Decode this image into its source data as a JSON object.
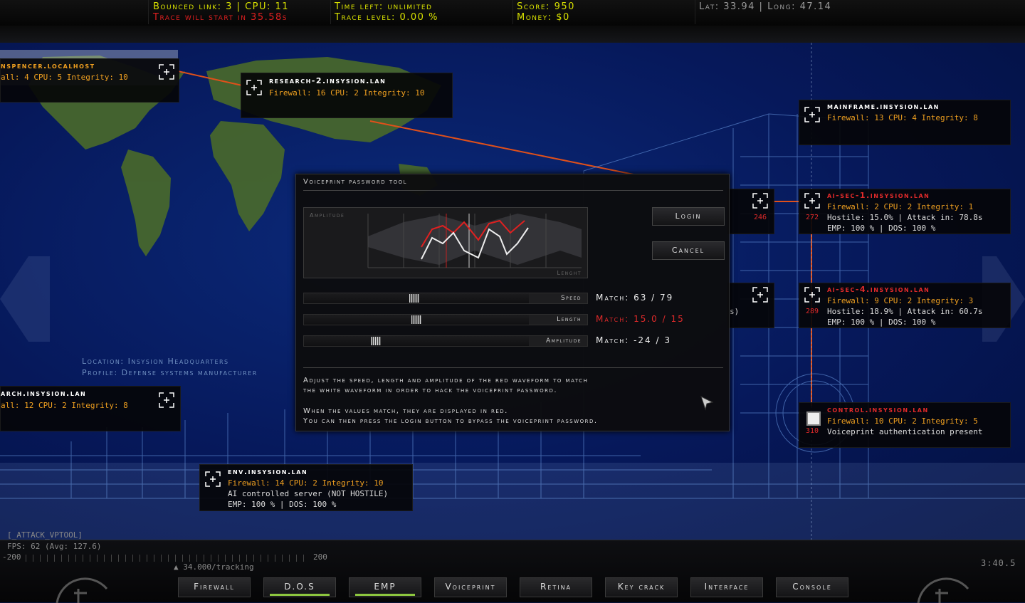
{
  "hud": {
    "bounced_link": "Bounced link: 3 | CPU: 11",
    "trace_start": "Trace will start in 35.58s",
    "time_left": "Time left: unlimited",
    "trace_level": "Trace level: 0.00 %",
    "score": "Score: 950",
    "money": "Money: $0",
    "coords": "Lat: 33.94 | Long: 47.14"
  },
  "location": {
    "line1": "Location: Insysion Headquarters",
    "line2": "Profile: Defense systems manufacturer"
  },
  "nodes": {
    "spencer": {
      "name": "nspencer.localhost",
      "line1": "all: 4 CPU: 5 Integrity: 10"
    },
    "research2": {
      "name": "research-2.insysion.lan",
      "line1": "Firewall: 16 CPU: 2 Integrity: 10"
    },
    "mainframe": {
      "name": "mainframe.insysion.lan",
      "line1": "Firewall: 13 CPU: 4 Integrity: 8"
    },
    "aisec1": {
      "name": "ai-sec-1.insysion.lan",
      "line1": "Firewall: 2 CPU: 2 Integrity: 1",
      "line2": "Hostile: 15.0% | Attack in: 78.8s",
      "line3": "EMP: 100 % | DOS: 100 %",
      "num": "272",
      "leftnum": "246"
    },
    "aisec4": {
      "name": "ai-sec-4.insysion.lan",
      "line1": "Firewall: 9 CPU: 2 Integrity: 3",
      "line2": "Hostile: 18.9% | Attack in: 60.7s",
      "line3": "EMP: 100 % | DOS: 100 %",
      "num": "289",
      "partial": "s)"
    },
    "research": {
      "name": "arch.insysion.lan",
      "line1": "all: 12 CPU: 2 Integrity: 8"
    },
    "control": {
      "name": "control.insysion.lan",
      "line1": "Firewall: 10 CPU: 2 Integrity: 5",
      "line2": "Voiceprint authentication present",
      "num": "310"
    },
    "env": {
      "name": "env.insysion.lan",
      "line1": "Firewall: 14 CPU: 2 Integrity: 10",
      "line2": "AI controlled server (NOT HOSTILE)",
      "line3": "EMP: 100 % | DOS: 100 %"
    }
  },
  "dialog": {
    "title": "Voiceprint password tool",
    "amplitude_label": "Amplitude",
    "length_axis": "Lenght",
    "login": "Login",
    "cancel": "Cancel",
    "speed_label": "Speed",
    "length_label": "Length",
    "amp_label": "Amplitude",
    "speed_match": "Match: 63 / 79",
    "length_match": "Match: 15.0 / 15",
    "amp_match": "Match: -24 / 3",
    "speed_value": 0.49,
    "length_value": 0.5,
    "amplitude_value": 0.31,
    "instr1": "Adjust the speed, length and amplitude of the red waveform to match",
    "instr2": "the white waveform in order to hack the voiceprint password.",
    "instr3": "When the values match, they are displayed in red.",
    "instr4": "You can then press the login button to bypass the voiceprint password."
  },
  "bottom": {
    "attack_tag": "[_ATTACK_VPTOOL]",
    "fps": "FPS:  62 (Avg: 127.6)",
    "axis_min": "-200",
    "axis_max": "200",
    "tracking": "34.000/tracking",
    "clock": "3:40.5",
    "tools": [
      "Firewall",
      "D.O.S",
      "EMP",
      "Voiceprint",
      "Retina",
      "Key crack",
      "Interface",
      "Console"
    ]
  },
  "colors": {
    "accent_red": "#e02a2a",
    "hud_yellow": "#d8e000",
    "info_orange": "#f0a020",
    "active_green": "#8dc63f"
  }
}
